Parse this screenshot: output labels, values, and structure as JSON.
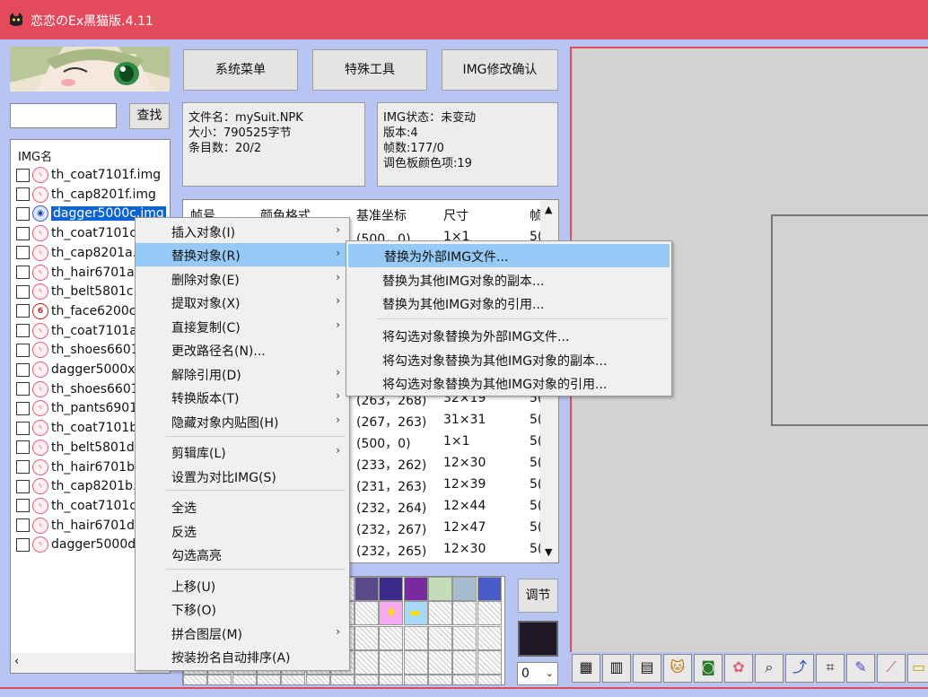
{
  "window": {
    "title": "恋恋のEx黑猫版.4.11"
  },
  "toolbar": {
    "system_menu": "系统菜单",
    "special_tools": "特殊工具",
    "img_confirm": "IMG修改确认"
  },
  "search": {
    "button": "查找",
    "value": ""
  },
  "file_info": {
    "name": "文件名：mySuit.NPK",
    "size": "大小：790525字节",
    "entries": "条目数：20/2"
  },
  "img_info": {
    "status": "IMG状态：未变动",
    "version": "版本:4",
    "frames": "帧数:177/0",
    "palette": "调色板颜色项:19"
  },
  "img_list": {
    "header": "IMG名",
    "items": [
      "th_coat7101f.img",
      "th_cap8201f.img",
      "dagger5000c.img",
      "th_coat7101c",
      "th_cap8201a.",
      "th_hair6701a.",
      "th_belt5801c",
      "th_face6200c",
      "th_coat7101a",
      "th_shoes6601",
      "dagger5000x.",
      "th_shoes6601",
      "th_pants6901",
      "th_coat7101b",
      "th_belt5801d",
      "th_hair6701b.",
      "th_cap8201b.",
      "th_coat7101d",
      "th_hair6701d.",
      "dagger5000d."
    ]
  },
  "frame_table": {
    "columns": [
      "帧号",
      "颜色格式",
      "基准坐标",
      "尺寸",
      "帧"
    ],
    "rows": [
      {
        "coord": "(500，0)",
        "size": "1×1",
        "f": "5("
      },
      {
        "coord": "(263，268)",
        "size": "32×19",
        "f": "5("
      },
      {
        "coord": "(267，263)",
        "size": "31×31",
        "f": "5("
      },
      {
        "coord": "(500，0)",
        "size": "1×1",
        "f": "5("
      },
      {
        "coord": "(233，262)",
        "size": "12×30",
        "f": "5("
      },
      {
        "coord": "(231，263)",
        "size": "12×39",
        "f": "5("
      },
      {
        "coord": "(232，264)",
        "size": "12×44",
        "f": "5("
      },
      {
        "coord": "(232，267)",
        "size": "12×47",
        "f": "5("
      },
      {
        "coord": "(232，265)",
        "size": "12×30",
        "f": "5("
      }
    ]
  },
  "context_menu": {
    "items": [
      "插入对象(I)",
      "替换对象(R)",
      "删除对象(E)",
      "提取对象(X)",
      "直接复制(C)",
      "更改路径名(N)...",
      "解除引用(D)",
      "转换版本(T)",
      "隐藏对象内贴图(H)",
      "剪辑库(L)",
      "设置为对比IMG(S)",
      "全选",
      "反选",
      "勾选高亮",
      "上移(U)",
      "下移(O)",
      "拼合图层(M)",
      "按装扮名自动排序(A)"
    ]
  },
  "submenu": {
    "items": [
      "替换为外部IMG文件...",
      "替换为其他IMG对象的副本...",
      "替换为其他IMG对象的引用...",
      "将勾选对象替换为外部IMG文件...",
      "将勾选对象替换为其他IMG对象的副本...",
      "将勾选对象替换为其他IMG对象的引用..."
    ]
  },
  "palette": {
    "adjust_button": "调节",
    "selector_value": "0",
    "current_color": "#1e1826"
  },
  "colors": {
    "titlebar": "#e34b5d",
    "client": "#b8c4f2",
    "highlight": "#96c9f5",
    "selection": "#0a64d2"
  }
}
